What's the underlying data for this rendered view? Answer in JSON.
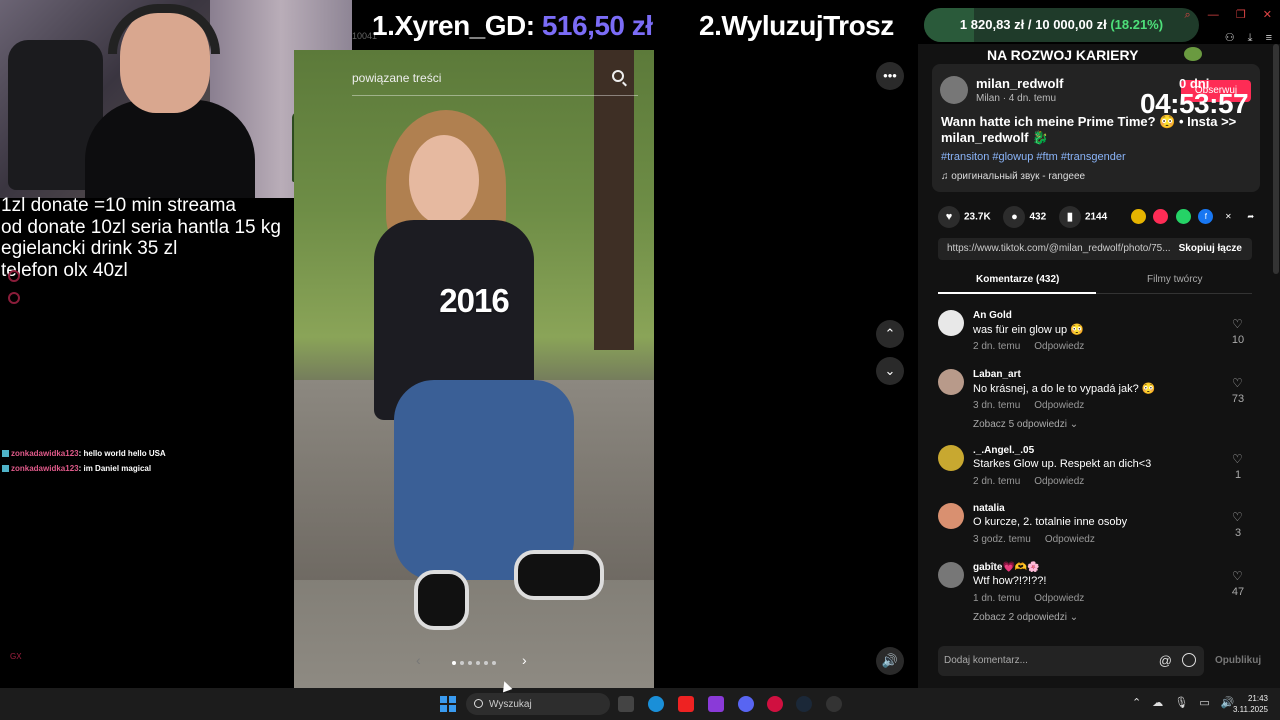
{
  "overlay": {
    "lines": [
      "1zl donate =10 min streama",
      "od donate 10zl seria hantla 15 kg",
      "egielancki drink 35 zl",
      "telefon olx 40zl"
    ],
    "gx_label": "GX"
  },
  "chat": [
    {
      "user": "zonkadawidka123",
      "message": ": hello world hello USA"
    },
    {
      "user": "zonkadawidka123",
      "message": ": im Daniel magical"
    }
  ],
  "banner": {
    "rank1": "1.",
    "name1": "Xyren_GD:",
    "amount1": "516,50 zł",
    "entry2": "2.WyluzujTrosz",
    "small_id": "10041"
  },
  "goal": {
    "current": "1 820,83 zł",
    "separator": "/",
    "target": "10 000,00 zł",
    "percent": "(18.21%)",
    "fraction": 0.1821
  },
  "goal_title": "NA ROZWOJ KARIERY",
  "photo": {
    "year_label": "2016",
    "related_placeholder": "powiązane treści",
    "page_count": 6,
    "active_page": 0
  },
  "post": {
    "author": "milan_redwolf",
    "author_display": "Milan",
    "author_time": "· 4 dn. temu",
    "follow_label": "Obserwuj",
    "timer_days": "0 dni",
    "timer_clock": "04:53:57",
    "caption": "Wann hatte ich meine Prime Time? 😳 • Insta >> milan_redwolf 🐉",
    "hashtags": "#transiton #glowup #ftm #transgender",
    "sound": "оригинальный звук - rangeee",
    "likes": "23.7K",
    "comments": "432",
    "saves": "2144",
    "url": "https://www.tiktok.com/@milan_redwolf/photo/75...",
    "copy_label": "Skopiuj łącze"
  },
  "tabs": {
    "comments": "Komentarze (432)",
    "creator_videos": "Filmy twórcy"
  },
  "comments_list": [
    {
      "name": "An Gold",
      "text": "was für ein glow up 😳",
      "time": "2 dn. temu",
      "reply": "Odpowiedz",
      "likes": "10",
      "replies": "",
      "avatar_color": "#e8e8e8"
    },
    {
      "name": "Laban_art",
      "text": "No krásnej, a do le to vypadá jak? 😳",
      "time": "3 dn. temu",
      "reply": "Odpowiedz",
      "likes": "73",
      "replies": "Zobacz 5 odpowiedzi ⌄",
      "avatar_color": "#b89a8a"
    },
    {
      "name": "._.Angel._.05",
      "text": "Starkes Glow up. Respekt an dich<3",
      "time": "2 dn. temu",
      "reply": "Odpowiedz",
      "likes": "1",
      "replies": "",
      "avatar_color": "#c8a830"
    },
    {
      "name": "natalia",
      "text": "O kurcze, 2. totalnie inne osoby",
      "time": "3 godz. temu",
      "reply": "Odpowiedz",
      "likes": "3",
      "replies": "",
      "avatar_color": "#d99070"
    },
    {
      "name": "gabîte💗🫶🌸",
      "text": "Wtf how?!?!??!",
      "time": "1 dn. temu",
      "reply": "Odpowiedz",
      "likes": "47",
      "replies": "Zobacz 2 odpowiedzi ⌄",
      "avatar_color": "#777"
    }
  ],
  "compose": {
    "placeholder": "Dodaj komentarz...",
    "publish": "Opublikuj"
  },
  "taskbar": {
    "search_label": "Wyszukaj",
    "time": "21:43",
    "date": "3.11.2025"
  },
  "colors": {
    "accent_purple": "#7b6cf6",
    "tiktok_red": "#fe2c55",
    "goal_green": "#4ee07a"
  }
}
